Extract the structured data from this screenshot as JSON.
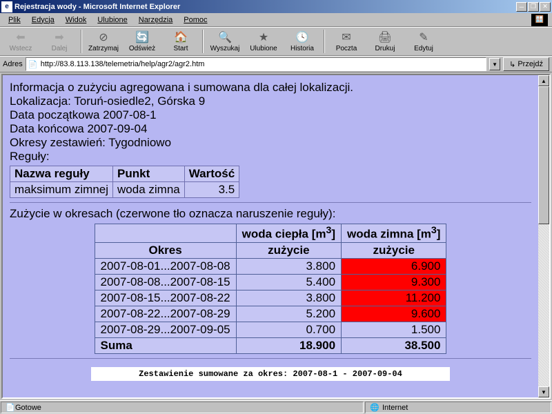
{
  "title": "Rejestracja wody - Microsoft Internet Explorer",
  "menu": {
    "file": "Plik",
    "edit": "Edycja",
    "view": "Widok",
    "fav": "Ulubione",
    "tools": "Narzędzia",
    "help": "Pomoc"
  },
  "toolbar": {
    "back": "Wstecz",
    "forward": "Dalej",
    "stop": "Zatrzymaj",
    "refresh": "Odśwież",
    "home": "Start",
    "search": "Wyszukaj",
    "favorites": "Ulubione",
    "history": "Historia",
    "mail": "Poczta",
    "print": "Drukuj",
    "edit": "Edytuj"
  },
  "address": {
    "label": "Adres",
    "url": "http://83.8.113.138/telemetria/help/agr2/agr2.htm",
    "go": "Przejdź"
  },
  "page": {
    "info_line": "Informacja o zużyciu agregowana i sumowana dla całej lokalizacji.",
    "loc_label": "Lokalizacja: Toruń-osiedle2, Górska 9",
    "date_start": "Data początkowa 2007-08-1",
    "date_end": "Data końcowa 2007-09-04",
    "periods": "Okresy zestawień: Tygodniowo",
    "rules_label": "Reguły:",
    "rules_table": {
      "headers": {
        "name": "Nazwa reguły",
        "point": "Punkt",
        "value": "Wartość"
      },
      "rows": [
        {
          "name": "maksimum zimnej",
          "point": "woda zimna",
          "value": "3.5"
        }
      ]
    },
    "usage_heading": "Zużycie w okresach (czerwone tło oznacza naruszenie reguły):",
    "usage_table": {
      "col_hot": "woda ciepła [m",
      "col_cold": "woda zimna [m",
      "sup": "3",
      "bracket": "]",
      "period": "Okres",
      "usage_word": "zużycie",
      "rows": [
        {
          "period": "2007-08-01...2007-08-08",
          "hot": "3.800",
          "cold": "6.900",
          "violation": true
        },
        {
          "period": "2007-08-08...2007-08-15",
          "hot": "5.400",
          "cold": "9.300",
          "violation": true
        },
        {
          "period": "2007-08-15...2007-08-22",
          "hot": "3.800",
          "cold": "11.200",
          "violation": true
        },
        {
          "period": "2007-08-22...2007-08-29",
          "hot": "5.200",
          "cold": "9.600",
          "violation": true
        },
        {
          "period": "2007-08-29...2007-09-05",
          "hot": "0.700",
          "cold": "1.500",
          "violation": false
        }
      ],
      "sum": {
        "label": "Suma",
        "hot": "18.900",
        "cold": "38.500"
      }
    },
    "bottom_text": "Zestawienie sumowane za okres: 2007-08-1 - 2007-09-04"
  },
  "status": {
    "ready": "Gotowe",
    "zone": "Internet"
  },
  "chart_data": {
    "type": "table",
    "title": "Zużycie w okresach",
    "columns": [
      "Okres",
      "woda ciepła [m3] zużycie",
      "woda zimna [m3] zużycie"
    ],
    "rows": [
      [
        "2007-08-01...2007-08-08",
        3.8,
        6.9
      ],
      [
        "2007-08-08...2007-08-15",
        5.4,
        9.3
      ],
      [
        "2007-08-15...2007-08-22",
        3.8,
        11.2
      ],
      [
        "2007-08-22...2007-08-29",
        5.2,
        9.6
      ],
      [
        "2007-08-29...2007-09-05",
        0.7,
        1.5
      ]
    ],
    "totals": [
      "Suma",
      18.9,
      38.5
    ],
    "violation_threshold_cold": 3.5
  }
}
